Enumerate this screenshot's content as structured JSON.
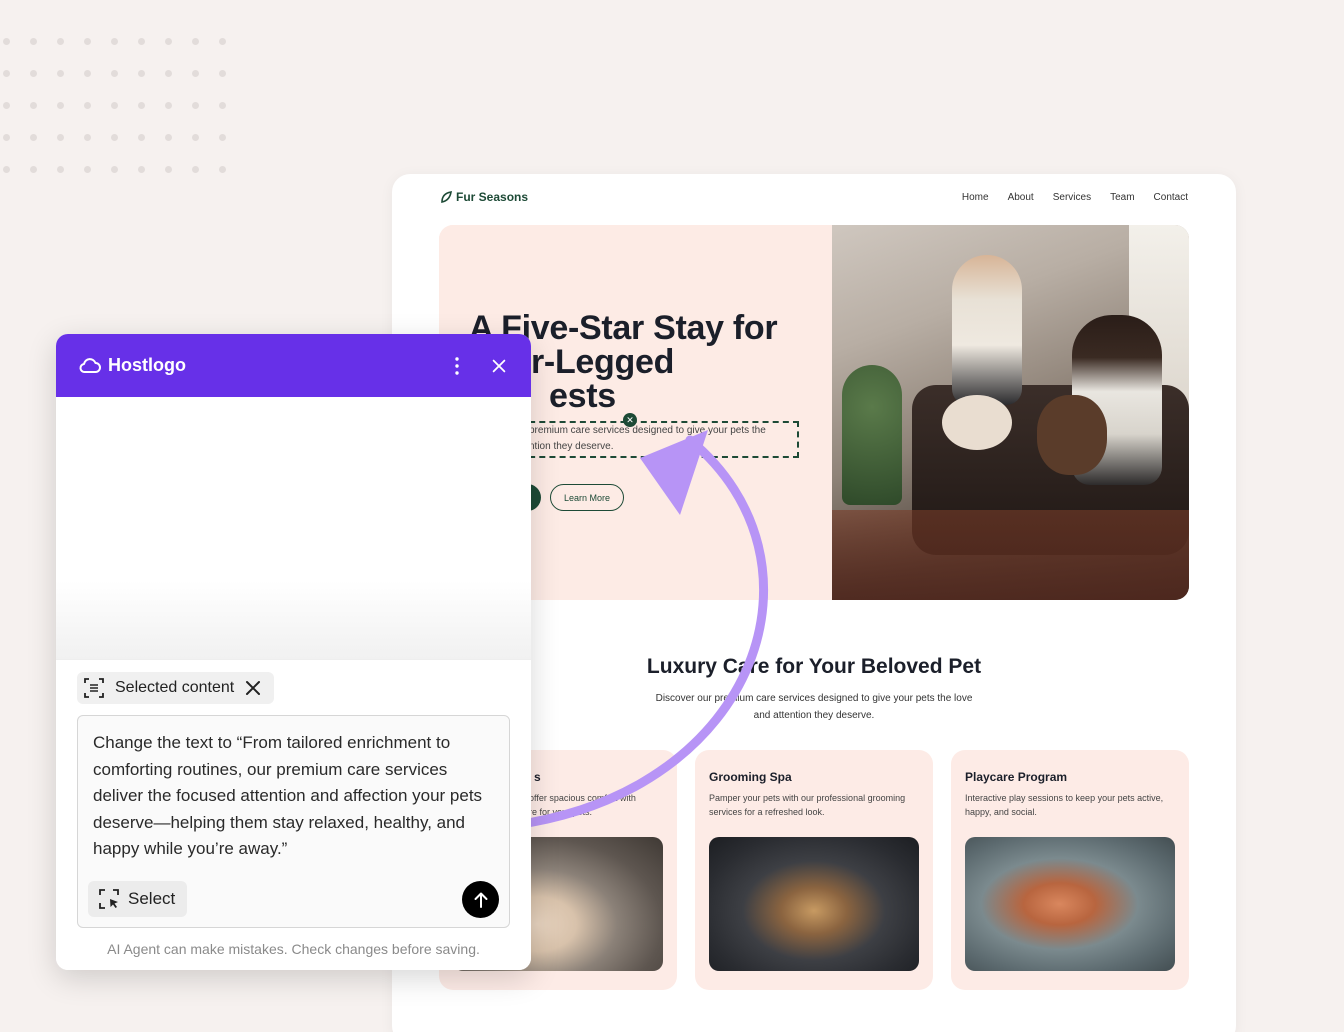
{
  "colors": {
    "panel_header": "#6730e8",
    "brand_green": "#1d4a36",
    "hero_bg": "#fdebe5",
    "arrow": "#b794f6",
    "page_bg": "#f6f1ef"
  },
  "site": {
    "brand": "Fur Seasons",
    "brand_icon": "leaf-icon",
    "nav": [
      "Home",
      "About",
      "Services",
      "Team",
      "Contact"
    ],
    "hero": {
      "title": "A Five-Star Stay for Four-Legged Guests",
      "title_visible_lines": [
        "A Five-Star Stay for",
        "r-Legged",
        "ests"
      ],
      "desc_line1": "premium care services designed to give your pets the",
      "desc_line2": "ntion they deserve.",
      "learn_more": "Learn More"
    },
    "section": {
      "title": "Luxury Care for Your Beloved Pet",
      "subtitle": "Discover our premium care services designed to give your pets the love and attention they deserve."
    },
    "cards": [
      {
        "title": "s",
        "desc": "offer spacious comfort with\nre for your pets."
      },
      {
        "title": "Grooming Spa",
        "desc": "Pamper your pets with our professional grooming services for a refreshed look."
      },
      {
        "title": "Playcare Program",
        "desc": "Interactive play sessions to keep your pets active, happy, and social."
      }
    ]
  },
  "panel": {
    "logo": "Hostlogo",
    "logo_icon": "cloud-icon",
    "chip_label": "Selected content",
    "prompt": "Change the text to “From tailored enrichment to comforting routines, our premium care services deliver the focused attention and affection your pets deserve—helping them stay relaxed, healthy, and happy while you’re away.”",
    "select_label": "Select",
    "disclaimer": "AI Agent can make mistakes. Check changes before saving."
  }
}
